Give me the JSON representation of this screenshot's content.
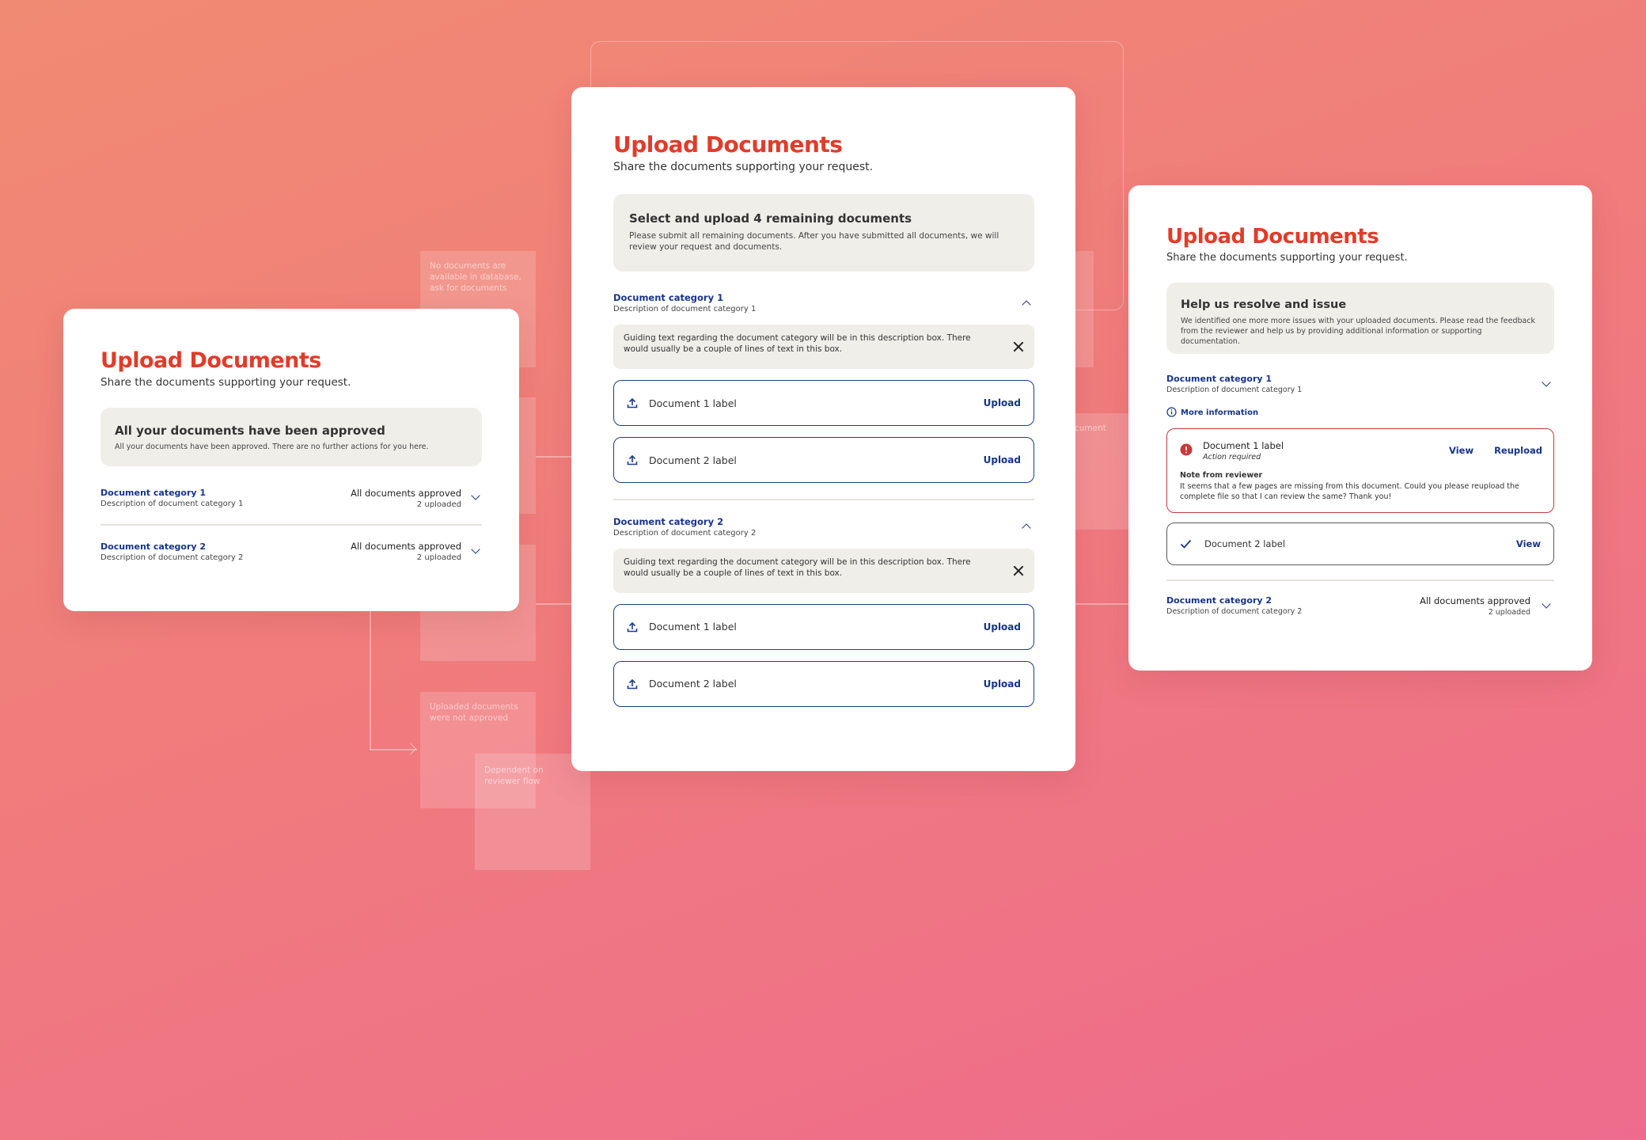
{
  "flow": {
    "box1_text": "No documents are available in database, ask for documents",
    "box2_text": "Uploaded documents were not approved",
    "box3_text": "Dependent on reviewer flow",
    "right_fragment": "cument"
  },
  "card_left": {
    "title": "Upload Documents",
    "subtitle": "Share the documents supporting your request.",
    "banner_title": "All your documents have been approved",
    "banner_text": "All your documents have been approved. There are no further actions for you here.",
    "categories": [
      {
        "title": "Document category 1",
        "desc": "Description of document category 1",
        "status": "All documents approved",
        "count": "2 uploaded"
      },
      {
        "title": "Document category 2",
        "desc": "Description of document category 2",
        "status": "All documents approved",
        "count": "2 uploaded"
      }
    ]
  },
  "card_center": {
    "title": "Upload Documents",
    "subtitle": "Share the documents supporting your request.",
    "banner_title": "Select and upload 4 remaining documents",
    "banner_text": "Please submit all remaining documents. After you have submitted all documents, we will review your request and documents.",
    "categories": [
      {
        "title": "Document category 1",
        "desc": "Description of document category 1",
        "guide": "Guiding text regarding the document category will be in this description box. There would usually be a couple of lines of text in this box.",
        "docs": [
          {
            "label": "Document 1 label",
            "action": "Upload"
          },
          {
            "label": "Document 2 label",
            "action": "Upload"
          }
        ]
      },
      {
        "title": "Document category 2",
        "desc": "Description of document category 2",
        "guide": "Guiding text regarding the document category will be in this description box. There would usually be a couple of lines of text in this box.",
        "docs": [
          {
            "label": "Document 1 label",
            "action": "Upload"
          },
          {
            "label": "Document 2 label",
            "action": "Upload"
          }
        ]
      }
    ]
  },
  "card_right": {
    "title": "Upload Documents",
    "subtitle": "Share the documents supporting your request.",
    "banner_title": "Help us resolve and issue",
    "banner_text": "We identified one more more issues with your uploaded documents. Please read the feedback from the reviewer and help us by providing additional information or supporting documentation.",
    "category1": {
      "title": "Document category 1",
      "desc": "Description of document category 1",
      "more_info": "More information",
      "doc1": {
        "label": "Document 1 label",
        "status": "Action required",
        "view": "View",
        "reupload": "Reupload",
        "note_title": "Note from reviewer",
        "note_text": "It seems that a few pages are missing from this document. Could you please reupload the complete file so that I can review the same? Thank you!"
      },
      "doc2": {
        "label": "Document 2 label",
        "view": "View"
      }
    },
    "category2": {
      "title": "Document category 2",
      "desc": "Description of document category 2",
      "status": "All documents approved",
      "count": "2 uploaded"
    }
  },
  "colors": {
    "accent": "#e23b2a",
    "link": "#17348a",
    "error": "#c73a3a",
    "banner": "#f0eee9"
  }
}
